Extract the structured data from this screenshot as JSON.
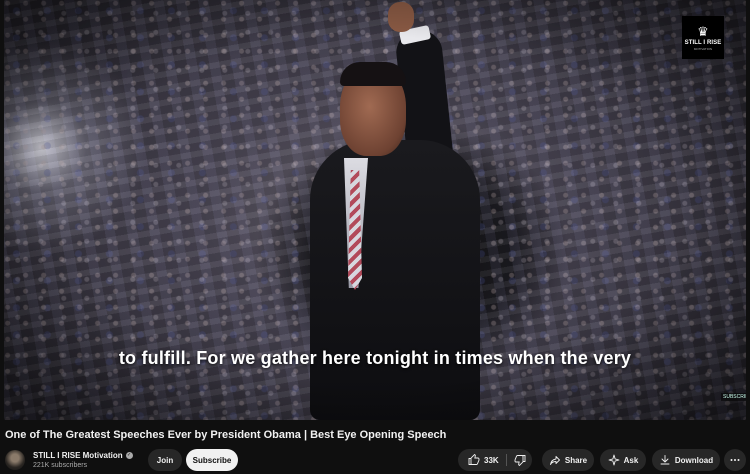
{
  "video": {
    "subtitle_text": "to fulfill. For we gather here tonight in times when the very",
    "watermark_logo": {
      "name": "STILL I RISE",
      "icon": "crown-icon",
      "tagline": "MOTIVATION"
    },
    "corner_badge": "SUBSCRIBE"
  },
  "title": "One of The Greatest Speeches Ever by President Obama | Best Eye Opening Speech",
  "channel": {
    "name": "STILL I RISE Motivation",
    "verified_icon": "check-icon",
    "subscribers": "221K subscribers",
    "avatar_icon": "avatar"
  },
  "actions": {
    "join_label": "Join",
    "subscribe_label": "Subscribe",
    "like_count": "33K",
    "like_icon": "thumbs-up-icon",
    "dislike_icon": "thumbs-down-icon",
    "share_label": "Share",
    "share_icon": "share-icon",
    "ask_label": "Ask",
    "ask_icon": "sparkle-icon",
    "download_label": "Download",
    "download_icon": "download-icon",
    "more_icon": "more-horizontal-icon"
  },
  "colors": {
    "background": "#0f0f0f",
    "pill": "#272727",
    "subscribe_bg": "#f1f1f1",
    "text": "#f1f1f1",
    "secondary_text": "#aaaaaa"
  }
}
